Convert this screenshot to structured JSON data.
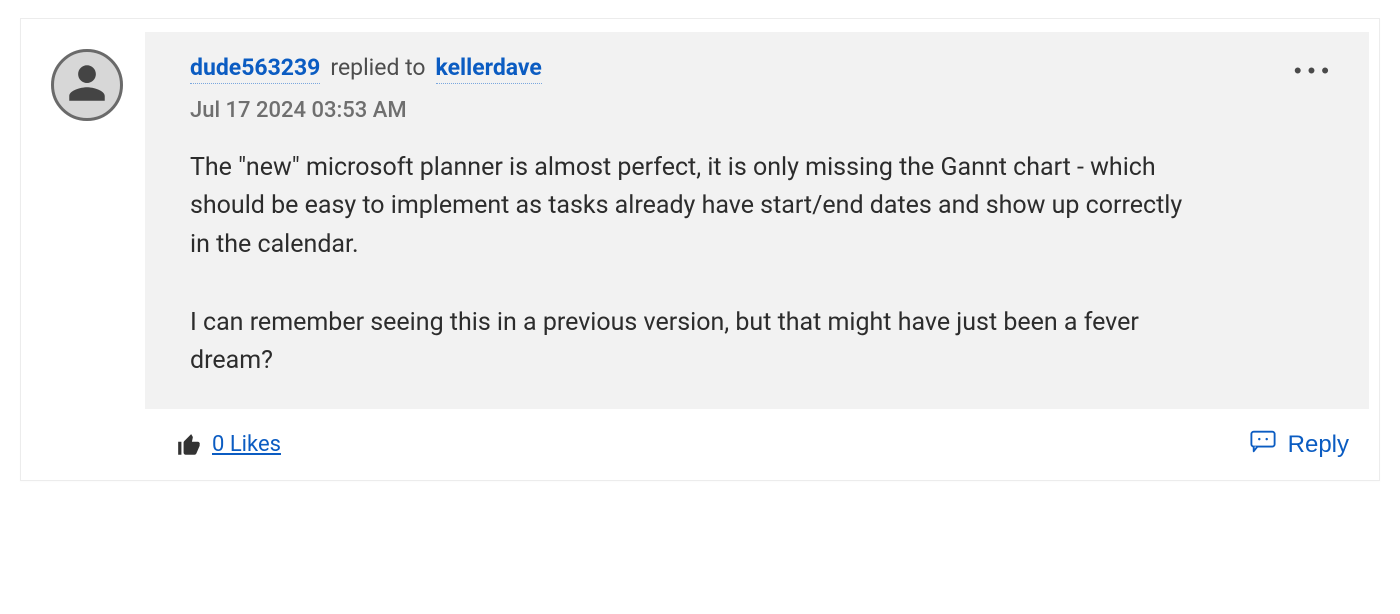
{
  "comment": {
    "author": "dude563239",
    "replied_to_label": "replied to",
    "target_user": "kellerdave",
    "timestamp": "Jul 17 2024  03:53 AM",
    "body": "The \"new\" microsoft planner is almost perfect, it is only missing the Gannt chart - which should be easy to implement as tasks already have start/end dates and show up correctly in the calendar.\n\nI can remember seeing this in a previous version, but that might have just been a fever dream?",
    "likes_text": "0 Likes",
    "reply_label": "Reply"
  },
  "icons": {
    "avatar": "default-user-avatar",
    "thumb": "thumb-up-icon",
    "reply": "reply-chat-icon",
    "options": "ellipsis-icon"
  },
  "colors": {
    "link": "#0b5cc2",
    "body_bg": "#f2f2f2",
    "muted_text": "#6f6f6f"
  }
}
